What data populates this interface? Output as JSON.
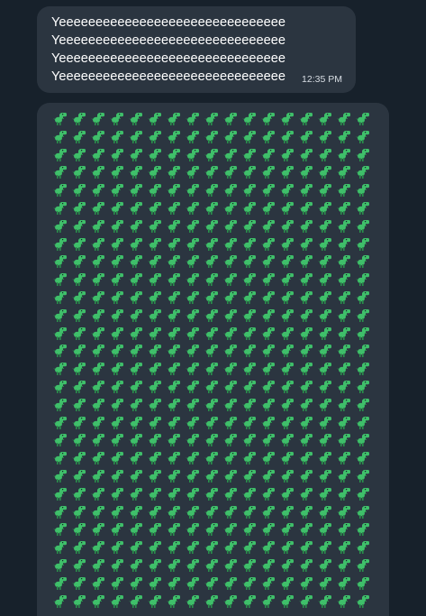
{
  "messages": [
    {
      "lines": [
        "Yeeeeeeeeeeeeeeeeeeeeeeeeeeeeeee",
        "Yeeeeeeeeeeeeeeeeeeeeeeeeeeeeeee",
        "Yeeeeeeeeeeeeeeeeeeeeeeeeeeeeeee",
        "Yeeeeeeeeeeeeeeeeeeeeeeeeeeeeeee"
      ],
      "time": "12:35 PM"
    },
    {
      "emoji": "t-rex",
      "emoji_rows": 28,
      "emoji_cols": 17
    }
  ],
  "colors": {
    "background": "#17212b",
    "bubble": "#2b3540",
    "dino_body": "#3fbf6a",
    "dino_dark": "#2a8f4c"
  }
}
